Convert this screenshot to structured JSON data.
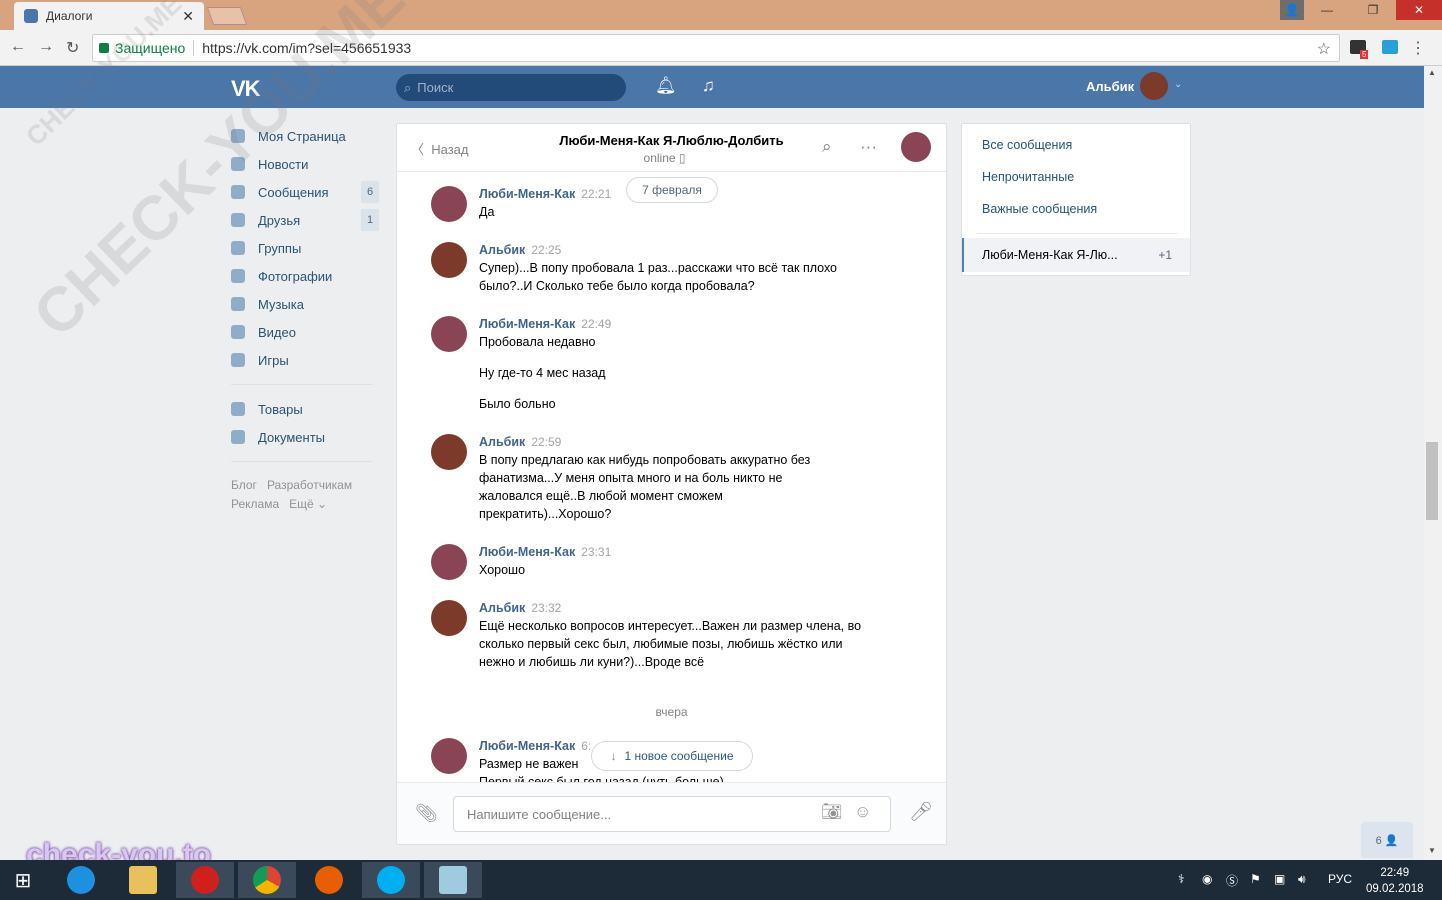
{
  "browser": {
    "tab_title": "Диалоги",
    "secure_label": "Защищено",
    "url": "https://vk.com/im?sel=456651933",
    "ext_badge": "5"
  },
  "vk": {
    "search_placeholder": "Поиск",
    "user_name": "Альбик"
  },
  "leftnav": {
    "items": [
      {
        "label": "Моя Страница",
        "icon": "home-icon"
      },
      {
        "label": "Новости",
        "icon": "news-icon"
      },
      {
        "label": "Сообщения",
        "icon": "messages-icon",
        "badge": "6"
      },
      {
        "label": "Друзья",
        "icon": "friends-icon",
        "badge": "1"
      },
      {
        "label": "Группы",
        "icon": "groups-icon"
      },
      {
        "label": "Фотографии",
        "icon": "camera-icon"
      },
      {
        "label": "Музыка",
        "icon": "music-icon"
      },
      {
        "label": "Видео",
        "icon": "video-icon"
      },
      {
        "label": "Игры",
        "icon": "games-icon"
      }
    ],
    "items2": [
      {
        "label": "Товары",
        "icon": "goods-icon"
      },
      {
        "label": "Документы",
        "icon": "documents-icon"
      }
    ],
    "footer": [
      "Блог",
      "Разработчикам",
      "Реклама",
      "Ещё ⌄"
    ]
  },
  "chat": {
    "back_label": "Назад",
    "title": "Люби-Меня-Как Я-Люблю-Долбить",
    "status": "online ▯",
    "date_pill": "7 февраля",
    "messages": [
      {
        "name": "Люби-Меня-Как",
        "time": "22:21",
        "lines": [
          "Да"
        ]
      },
      {
        "name": "Альбик",
        "time": "22:25",
        "lines": [
          "Супер)...В попу пробовала 1 раз...расскажи что всё так плохо было?..И Сколько тебе было когда пробовала?"
        ]
      },
      {
        "name": "Люби-Меня-Как",
        "time": "22:49",
        "lines": [
          "Пробовала недавно",
          "Ну где-то 4 мес назад",
          "Было больно"
        ]
      },
      {
        "name": "Альбик",
        "time": "22:59",
        "lines": [
          "В попу предлагаю как нибудь попробовать аккуратно без фанатизма...У меня опыта много и на боль никто не жаловался ещё..В любой момент сможем прекратить)...Хорошо?"
        ]
      },
      {
        "name": "Люби-Меня-Как",
        "time": "23:31",
        "lines": [
          "Хорошо"
        ]
      },
      {
        "name": "Альбик",
        "time": "23:32",
        "lines": [
          "Ещё несколько вопросов интересует...Важен ли размер члена, во сколько первый секс был, любимые позы, любишь жёстко или нежно и любишь ли куни?)...Вроде всё"
        ]
      },
      {
        "name": "Люби-Меня-Как",
        "time": "6:",
        "lines": [
          "Размер не важен",
          "Первый секс был год назад (чуть больше)"
        ]
      }
    ],
    "divider": "вчера",
    "new_pill": "1 новое сообщение",
    "input_placeholder": "Напишите сообщение..."
  },
  "rightpanel": {
    "items": [
      "Все сообщения",
      "Непрочитанные",
      "Важные сообщения"
    ],
    "active_name": "Люби-Меня-Как Я-Лю...",
    "active_count": "+1"
  },
  "online_count": "6 👤",
  "taskbar": {
    "lang": "РУС",
    "time": "22:49",
    "date": "09.02.2018"
  },
  "watermark": {
    "text": "CHECK-YOU.ME",
    "site": "check-you.to"
  }
}
